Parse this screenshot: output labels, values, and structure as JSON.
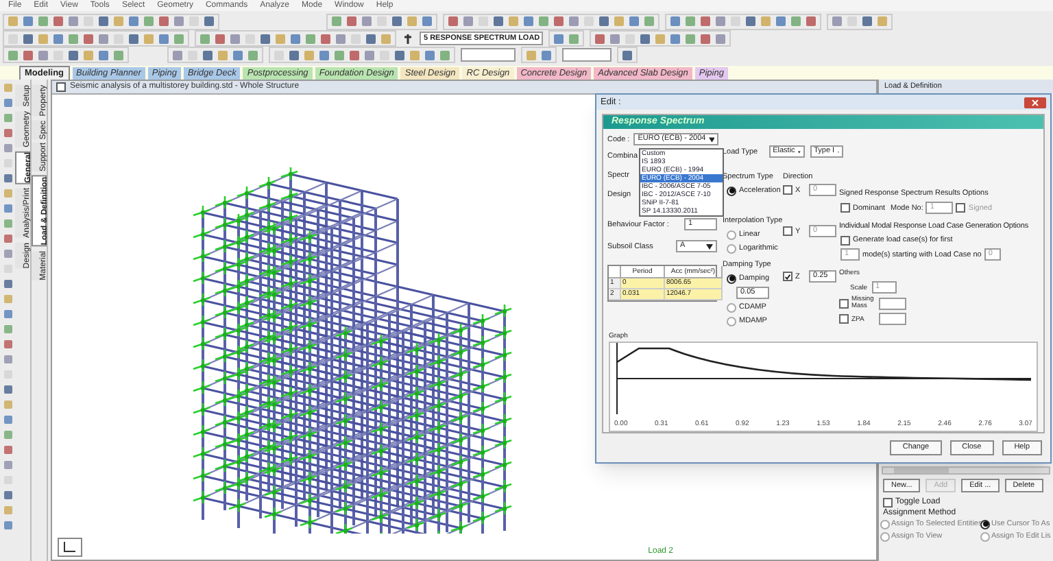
{
  "menu_bar": [
    "File",
    "Edit",
    "View",
    "Tools",
    "Select",
    "Geometry",
    "Commands",
    "Analyze",
    "Mode",
    "Window",
    "Help"
  ],
  "toolbar": {
    "load_case_dropdown": "5 RESPONSE SPECTRUM LOAD"
  },
  "mode_tabs": [
    {
      "label": "Modeling",
      "selected": true,
      "color": "#f0f0f0"
    },
    {
      "label": "Building Planner",
      "selected": false,
      "color": "#a9c8e8"
    },
    {
      "label": "Piping",
      "selected": false,
      "color": "#a9c8e8"
    },
    {
      "label": "Bridge Deck",
      "selected": false,
      "color": "#a9c8e8"
    },
    {
      "label": "Postprocessing",
      "selected": false,
      "color": "#b9e4b0"
    },
    {
      "label": "Foundation Design",
      "selected": false,
      "color": "#b9e4b0"
    },
    {
      "label": "Steel Design",
      "selected": false,
      "color": "#f3e6c0"
    },
    {
      "label": "RC Design",
      "selected": false,
      "color": "#f8efd0"
    },
    {
      "label": "Concrete Design",
      "selected": false,
      "color": "#f2b8c8"
    },
    {
      "label": "Advanced Slab Design",
      "selected": false,
      "color": "#f2b8c8"
    },
    {
      "label": "Piping",
      "selected": false,
      "color": "#e3c8f0"
    }
  ],
  "side_tabs": {
    "column_1": [
      {
        "label": "Setup",
        "selected": false
      },
      {
        "label": "Geometry",
        "selected": false
      },
      {
        "label": "General",
        "selected": true
      },
      {
        "label": "Analysis/Print",
        "selected": false
      },
      {
        "label": "Design",
        "selected": false
      }
    ],
    "column_2": [
      {
        "label": "Property",
        "selected": false
      },
      {
        "label": "Spec",
        "selected": false
      },
      {
        "label": "Support",
        "selected": false
      },
      {
        "label": "Load & Definition",
        "selected": true
      },
      {
        "label": "Material",
        "selected": false
      }
    ]
  },
  "viewport": {
    "title": "Seismic analysis of a multistorey building.std - Whole Structure",
    "load_label": "Load 2"
  },
  "dialog": {
    "title": "Edit :",
    "panel_title": "Response Spectrum",
    "code": {
      "label": "Code :",
      "value": "EURO (ECB) - 2004",
      "options": [
        {
          "label": "Custom",
          "selected": false
        },
        {
          "label": "IS 1893",
          "selected": false
        },
        {
          "label": "EURO (ECB) - 1994",
          "selected": false
        },
        {
          "label": "EURO (ECB) - 2004",
          "selected": true
        },
        {
          "label": "IBC - 2006/ASCE 7-05",
          "selected": false
        },
        {
          "label": "IBC - 2012/ASCE 7-10",
          "selected": false
        },
        {
          "label": "SNiP II-7-81",
          "selected": false
        },
        {
          "label": "SP 14.13330.2011",
          "selected": false
        }
      ]
    },
    "hidden_labels": [
      "Combina",
      "Spectr",
      "Design"
    ],
    "behaviour_factor": {
      "label": "Behaviour Factor :",
      "value": "1"
    },
    "subsoil_class": {
      "label": "Subsoil Class",
      "value": "A"
    },
    "table": {
      "columns": [
        "",
        "Period",
        "Acc (mm/sec²)"
      ],
      "rows": [
        [
          "1",
          "0",
          "8006.65"
        ],
        [
          "2",
          "0.031",
          "12046.7"
        ]
      ]
    },
    "load_type": {
      "label": "Load Type",
      "value": "Elastic",
      "type_value": "Type I"
    },
    "spectrum_type": {
      "label": "Spectrum Type",
      "options": [
        {
          "label": "Acceleration",
          "selected": true
        }
      ]
    },
    "direction": {
      "label": "Direction",
      "axes": [
        {
          "label": "X",
          "checked": false,
          "value": "0"
        },
        {
          "label": "Y",
          "checked": false,
          "value": "0"
        },
        {
          "label": "Z",
          "checked": true,
          "value": "0.25"
        }
      ]
    },
    "interpolation_type": {
      "label": "Interpolation Type",
      "options": [
        {
          "label": "Linear",
          "selected": false
        },
        {
          "label": "Logarithmic",
          "selected": false
        }
      ]
    },
    "damping_type": {
      "label": "Damping Type",
      "options": [
        {
          "label": "Damping",
          "selected": true
        },
        {
          "label": "CDAMP",
          "selected": false
        },
        {
          "label": "MDAMP",
          "selected": false
        }
      ],
      "damping_value": "0.05"
    },
    "signed_options": {
      "label": "Signed Response Spectrum Results Options",
      "dominant": {
        "label": "Dominant",
        "checked": false
      },
      "mode_no_label": "Mode No:",
      "mode_no": "1",
      "signed": {
        "label": "Signed",
        "checked": false
      }
    },
    "modal_options": {
      "label": "Individual Modal Response Load Case Generation Options",
      "generate": {
        "label": "Generate load case(s) for first",
        "checked": false
      },
      "modes": "1",
      "modes_text": "mode(s) starting with Load Case no",
      "load_case_no": "0"
    },
    "others": {
      "label": "Others",
      "scale_label": "Scale",
      "scale": "1",
      "missing_mass": {
        "label": "Missing Mass",
        "checked": false
      },
      "zpa": {
        "label": "ZPA",
        "checked": false
      }
    },
    "graph": {
      "label": "Graph",
      "x_tick_labels": [
        "0.00",
        "0.31",
        "0.61",
        "0.92",
        "1.23",
        "1.53",
        "1.84",
        "2.15",
        "2.46",
        "2.76",
        "3.07"
      ]
    },
    "buttons": [
      "Change",
      "Close",
      "Help"
    ]
  },
  "load_panel": {
    "title": "Load & Definition",
    "buttons": [
      {
        "label": "New...",
        "disabled": false
      },
      {
        "label": "Add",
        "disabled": true
      },
      {
        "label": "Edit ...",
        "disabled": false
      },
      {
        "label": "Delete",
        "disabled": false
      }
    ],
    "toggle_load": {
      "label": "Toggle Load",
      "checked": false
    },
    "assignment_label": "Assignment Method",
    "assignment_options": [
      {
        "label": "Assign To Selected Entities",
        "selected": false
      },
      {
        "label": "Use Cursor To As",
        "selected": true
      },
      {
        "label": "Assign To View",
        "selected": false
      },
      {
        "label": "Assign To Edit Lis",
        "selected": false
      }
    ]
  }
}
